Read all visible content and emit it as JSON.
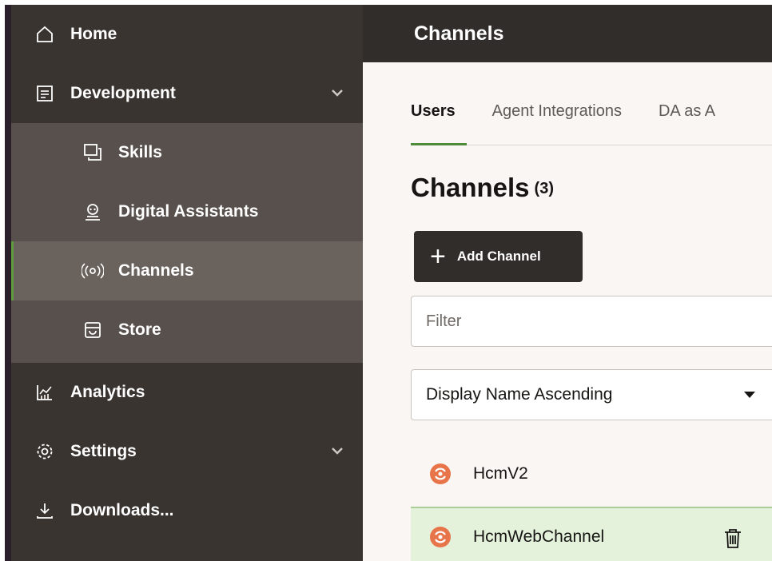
{
  "sidebar": {
    "items": [
      {
        "label": "Home"
      },
      {
        "label": "Development"
      },
      {
        "label": "Skills"
      },
      {
        "label": "Digital Assistants"
      },
      {
        "label": "Channels",
        "selected": true
      },
      {
        "label": "Store"
      },
      {
        "label": "Analytics"
      },
      {
        "label": "Settings"
      },
      {
        "label": "Downloads..."
      }
    ]
  },
  "header": {
    "title": "Channels"
  },
  "tabs": [
    {
      "label": "Users",
      "active": true
    },
    {
      "label": "Agent Integrations"
    },
    {
      "label": "DA as A"
    }
  ],
  "page": {
    "title": "Channels",
    "count": "(3)"
  },
  "actions": {
    "add_label": "Add Channel"
  },
  "filter": {
    "placeholder": "Filter"
  },
  "sort": {
    "value": "Display Name Ascending"
  },
  "channels": [
    {
      "name": "HcmV2"
    },
    {
      "name": "HcmWebChannel",
      "selected": true
    }
  ],
  "colors": {
    "sidebar_bg": "#3a3431",
    "sub_bg": "#57504c",
    "accent_green": "#4f8a3a",
    "selected_row_bg": "#e4f2dc",
    "channel_icon": "#e8744a"
  }
}
